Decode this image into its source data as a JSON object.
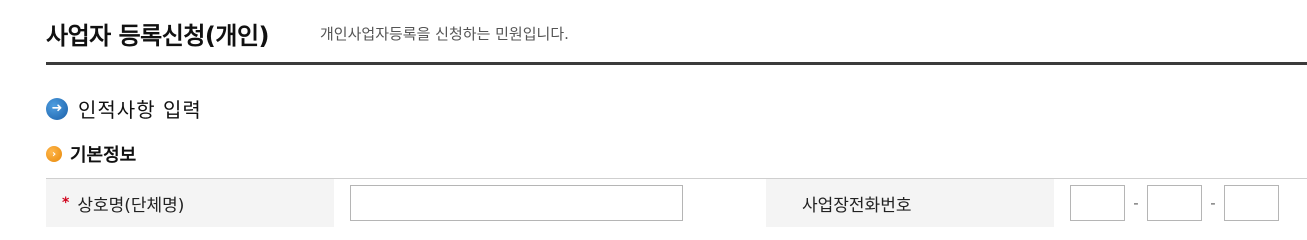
{
  "header": {
    "title": "사업자 등록신청(개인)",
    "description": "개인사업자등록을 신청하는 민원입니다."
  },
  "section": {
    "label": "인적사항 입력",
    "icon": "arrow-right-icon",
    "icon_color": "#1a5fa8"
  },
  "subsection": {
    "label": "기본정보",
    "icon": "chevron-right-icon",
    "icon_color": "#e7890b"
  },
  "form": {
    "business_name": {
      "required_mark": "*",
      "label": "상호명(단체명)",
      "value": ""
    },
    "business_phone": {
      "label": "사업장전화번호",
      "part1": "",
      "part2": "",
      "part3": "",
      "separator": "-"
    }
  }
}
